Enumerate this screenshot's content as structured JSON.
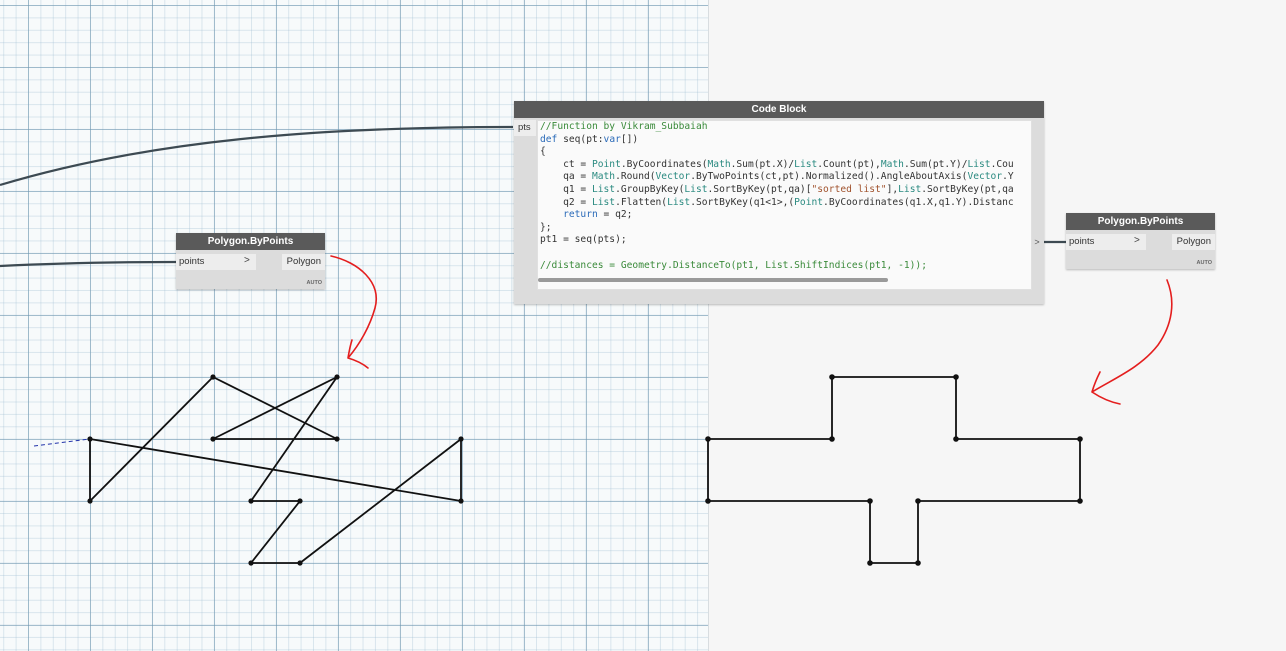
{
  "colors": {
    "wire": "#3d4a52",
    "annotation": "#e41e1e",
    "geometry": "#111111",
    "node_title_bg": "#5a5a5a"
  },
  "code_block": {
    "title": "Code Block",
    "input_port": "pts",
    "output_port_symbol": ">",
    "lines": [
      [
        {
          "t": "//Function by Vikram_Subbaiah",
          "c": "comment"
        }
      ],
      [
        {
          "t": "def ",
          "c": "kw"
        },
        {
          "t": "seq(pt:",
          "c": "txt"
        },
        {
          "t": "var",
          "c": "kw"
        },
        {
          "t": "[])",
          "c": "txt"
        }
      ],
      [
        {
          "t": "{",
          "c": "txt"
        }
      ],
      [
        {
          "t": "    ct = ",
          "c": "txt"
        },
        {
          "t": "Point",
          "c": "cls"
        },
        {
          "t": ".ByCoordinates(",
          "c": "txt"
        },
        {
          "t": "Math",
          "c": "cls"
        },
        {
          "t": ".Sum(pt.X)/",
          "c": "txt"
        },
        {
          "t": "List",
          "c": "cls"
        },
        {
          "t": ".Count(pt),",
          "c": "txt"
        },
        {
          "t": "Math",
          "c": "cls"
        },
        {
          "t": ".Sum(pt.Y)/",
          "c": "txt"
        },
        {
          "t": "List",
          "c": "cls"
        },
        {
          "t": ".Cou",
          "c": "txt"
        }
      ],
      [
        {
          "t": "    qa = ",
          "c": "txt"
        },
        {
          "t": "Math",
          "c": "cls"
        },
        {
          "t": ".Round(",
          "c": "txt"
        },
        {
          "t": "Vector",
          "c": "cls"
        },
        {
          "t": ".ByTwoPoints(ct,pt).Normalized().AngleAboutAxis(",
          "c": "txt"
        },
        {
          "t": "Vector",
          "c": "cls"
        },
        {
          "t": ".Y",
          "c": "txt"
        }
      ],
      [
        {
          "t": "    q1 = ",
          "c": "txt"
        },
        {
          "t": "List",
          "c": "cls"
        },
        {
          "t": ".GroupByKey(",
          "c": "txt"
        },
        {
          "t": "List",
          "c": "cls"
        },
        {
          "t": ".SortByKey(pt,qa)[",
          "c": "txt"
        },
        {
          "t": "\"sorted list\"",
          "c": "str"
        },
        {
          "t": "],",
          "c": "txt"
        },
        {
          "t": "List",
          "c": "cls"
        },
        {
          "t": ".SortByKey(pt,qa",
          "c": "txt"
        }
      ],
      [
        {
          "t": "    q2 = ",
          "c": "txt"
        },
        {
          "t": "List",
          "c": "cls"
        },
        {
          "t": ".Flatten(",
          "c": "txt"
        },
        {
          "t": "List",
          "c": "cls"
        },
        {
          "t": ".SortByKey(q1<1>,(",
          "c": "txt"
        },
        {
          "t": "Point",
          "c": "cls"
        },
        {
          "t": ".ByCoordinates(q1.X,q1.Y).Distanc",
          "c": "txt"
        }
      ],
      [
        {
          "t": "    ",
          "c": "txt"
        },
        {
          "t": "return",
          "c": "kw"
        },
        {
          "t": " = q2;",
          "c": "txt"
        }
      ],
      [
        {
          "t": "};",
          "c": "txt"
        }
      ],
      [
        {
          "t": "pt1 = seq(pts);",
          "c": "txt"
        }
      ],
      [
        {
          "t": "",
          "c": "txt"
        }
      ],
      [
        {
          "t": "//distances = Geometry.DistanceTo(pt1, List.ShiftIndices(pt1, -1));",
          "c": "comment"
        }
      ]
    ]
  },
  "polygon_node_left": {
    "title": "Polygon.ByPoints",
    "input": "points",
    "arrow": ">",
    "output": "Polygon",
    "lacing": "AUTO"
  },
  "polygon_node_right": {
    "title": "Polygon.ByPoints",
    "input": "points",
    "arrow": ">",
    "output": "Polygon",
    "lacing": "AUTO"
  }
}
